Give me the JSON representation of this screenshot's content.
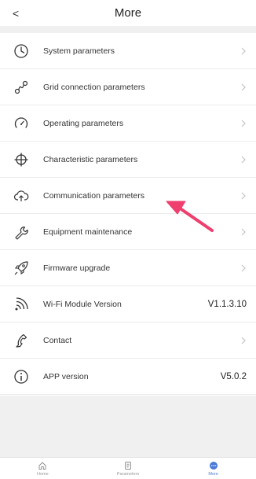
{
  "header": {
    "title": "More",
    "back_glyph": "<"
  },
  "menu": [
    {
      "label": "System parameters",
      "icon": "clock-icon",
      "chevron": true
    },
    {
      "label": "Grid connection parameters",
      "icon": "grid-link-icon",
      "chevron": true
    },
    {
      "label": "Operating parameters",
      "icon": "gauge-icon",
      "chevron": true
    },
    {
      "label": "Characteristic parameters",
      "icon": "crosshair-icon",
      "chevron": true
    },
    {
      "label": "Communication parameters",
      "icon": "cloud-upload-icon",
      "chevron": true
    },
    {
      "label": "Equipment maintenance",
      "icon": "wrench-icon",
      "chevron": true
    },
    {
      "label": "Firmware upgrade",
      "icon": "rocket-icon",
      "chevron": true
    },
    {
      "label": "Wi-Fi Module Version",
      "icon": "wifi-icon",
      "value": "V1.1.3.10"
    },
    {
      "label": "Contact",
      "icon": "phone-icon",
      "chevron": true
    },
    {
      "label": "APP version",
      "icon": "info-icon",
      "value": "V5.0.2"
    }
  ],
  "tabbar": [
    {
      "label": "Home",
      "icon": "home-icon",
      "active": false
    },
    {
      "label": "Parameters",
      "icon": "document-icon",
      "active": false
    },
    {
      "label": "More",
      "icon": "more-dots-icon",
      "active": true
    }
  ],
  "colors": {
    "accent": "#4a7bd9",
    "annotation_arrow": "#ee3f6e",
    "background_gray": "#f0f0f0"
  }
}
